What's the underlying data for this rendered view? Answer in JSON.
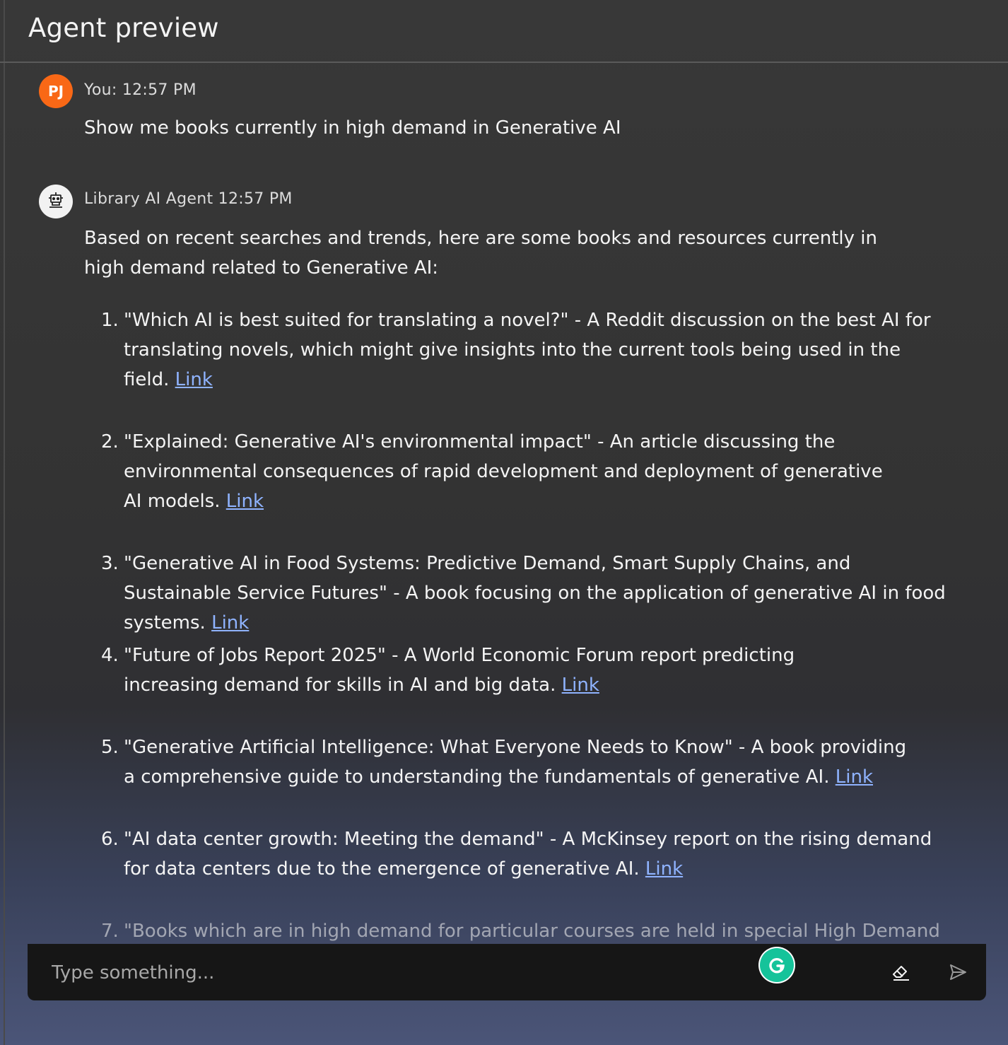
{
  "header": {
    "title": "Agent preview"
  },
  "messages": {
    "user": {
      "avatar_initials": "PJ",
      "meta": "You: 12:57 PM",
      "text": "Show me books currently in high demand in Generative AI"
    },
    "agent": {
      "avatar_icon": "robot-icon",
      "meta": "Library AI Agent 12:57 PM",
      "intro": "Based on recent searches and trends, here are some books and resources currently in high demand related to Generative AI:",
      "items": [
        {
          "num": "1.",
          "text": "\"Which AI is best suited for translating a novel?\" - A Reddit discussion on the best AI for translating novels, which might give insights into the current tools being used in the field. ",
          "link": "Link"
        },
        {
          "num": "2.",
          "text": "\"Explained: Generative AI's environmental impact\" - An article discussing the environmental consequences of rapid development and deployment of generative AI models. ",
          "link": "Link"
        },
        {
          "num": "3.",
          "text": "\"Generative AI in Food Systems: Predictive Demand, Smart Supply Chains, and Sustainable Service Futures\" - A book focusing on the application of generative AI in food systems. ",
          "link": "Link"
        },
        {
          "num": "4.",
          "text": "\"Future of Jobs Report 2025\" - A World Economic Forum report predicting increasing demand for skills in AI and big data. ",
          "link": "Link"
        },
        {
          "num": "5.",
          "text": "\"Generative Artificial Intelligence: What Everyone Needs to Know\" - A book providing a comprehensive guide to understanding the fundamentals of generative AI. ",
          "link": "Link"
        },
        {
          "num": "6.",
          "text": "\"AI data center growth: Meeting the demand\" - A McKinsey report on the rising demand for data centers due to the emergence of generative AI. ",
          "link": "Link"
        },
        {
          "num": "7.",
          "text": "\"Books which are in high demand for particular courses are held in special High Demand",
          "link": ""
        }
      ]
    }
  },
  "input": {
    "placeholder": "Type something...",
    "value": ""
  },
  "icons": {
    "grammarly": "grammarly-icon",
    "clear": "eraser-icon",
    "send": "send-icon"
  },
  "colors": {
    "user_avatar": "#f96816",
    "link": "#8fb3ff",
    "input_bg": "#161616",
    "grammarly": "#15c39a"
  }
}
